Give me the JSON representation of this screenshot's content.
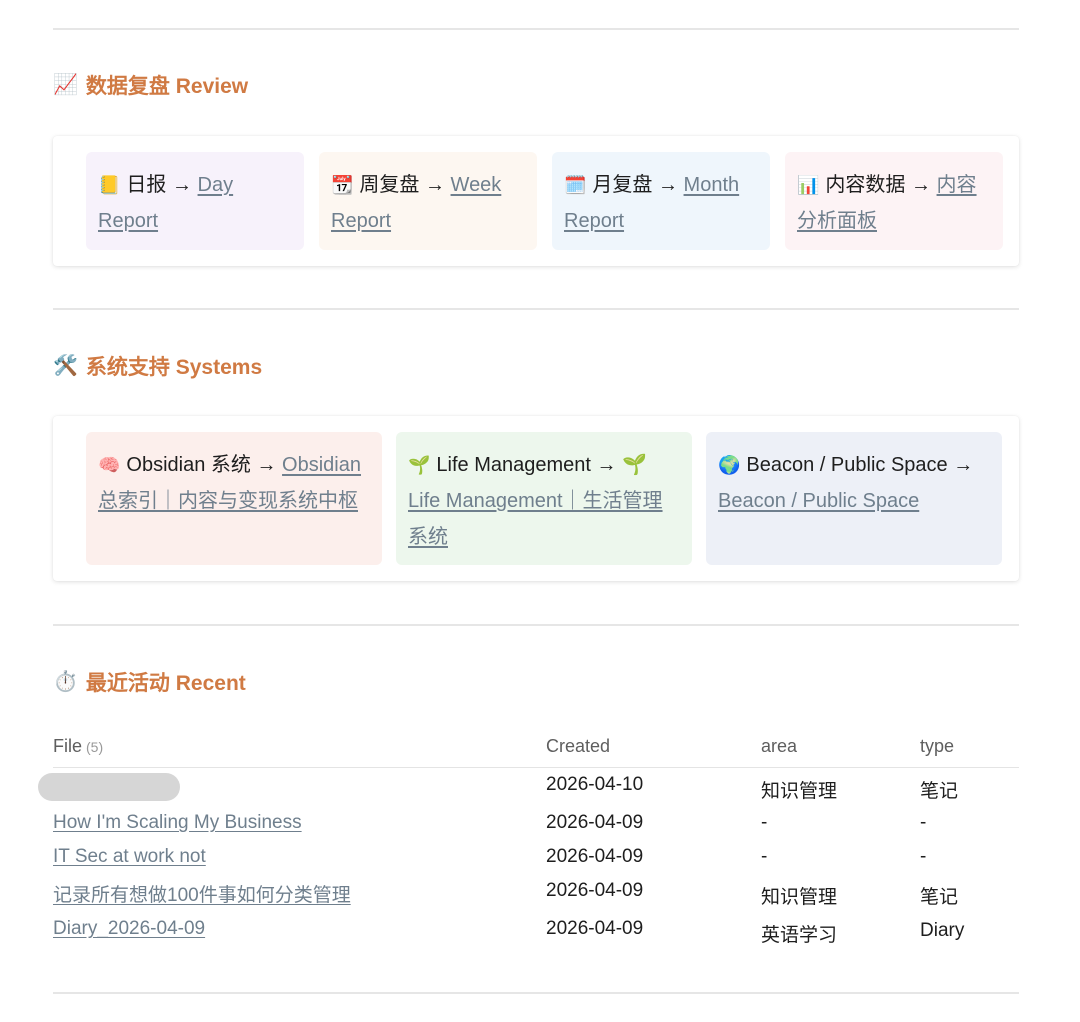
{
  "sections": {
    "review": {
      "icon": "📈",
      "title": "数据复盘 Review",
      "cards": [
        {
          "icon": "📒",
          "label": "日报 →",
          "link": "Day Report",
          "bg": "#f7f2fb"
        },
        {
          "icon": "📆",
          "label": "周复盘 →",
          "link": "Week Report",
          "bg": "#fdf7f1"
        },
        {
          "icon": "🗓️",
          "label": "月复盘 →",
          "link": "Month Report",
          "bg": "#eff6fc"
        },
        {
          "icon": "📊",
          "label": "内容数据 →",
          "link": "内容分析面板",
          "bg": "#fdf3f5"
        }
      ]
    },
    "systems": {
      "icon": "🛠️",
      "title": "系统支持 Systems",
      "cards": [
        {
          "icon": "🧠",
          "label": "Obsidian 系统 →",
          "link": "Obsidian总索引｜内容与变现系统中枢",
          "bg": "#fcefec"
        },
        {
          "icon": "🌱",
          "label": "Life Management → 🌱",
          "link": "Life Management｜生活管理系统",
          "bg": "#edf7ed"
        },
        {
          "icon": "🌍",
          "label": "Beacon / Public Space →",
          "link": "Beacon / Public Space",
          "bg": "#edf0f7"
        }
      ]
    },
    "recent": {
      "icon": "⏱️",
      "title": "最近活动 Recent",
      "table": {
        "columns": {
          "file": "File",
          "file_count": "(5)",
          "created": "Created",
          "area": "area",
          "type": "type"
        },
        "rows": [
          {
            "file": "",
            "created": "2026-04-10",
            "area": "知识管理",
            "type": "笔记",
            "redacted": true
          },
          {
            "file": "How I'm Scaling My Business",
            "created": "2026-04-09",
            "area": "-",
            "type": "-"
          },
          {
            "file": "IT Sec at work not",
            "created": "2026-04-09",
            "area": "-",
            "type": "-"
          },
          {
            "file": "记录所有想做100件事如何分类管理",
            "created": "2026-04-09",
            "area": "知识管理",
            "type": "笔记"
          },
          {
            "file": "Diary_2026-04-09",
            "created": "2026-04-09",
            "area": "英语学习",
            "type": "Diary"
          }
        ]
      }
    }
  }
}
